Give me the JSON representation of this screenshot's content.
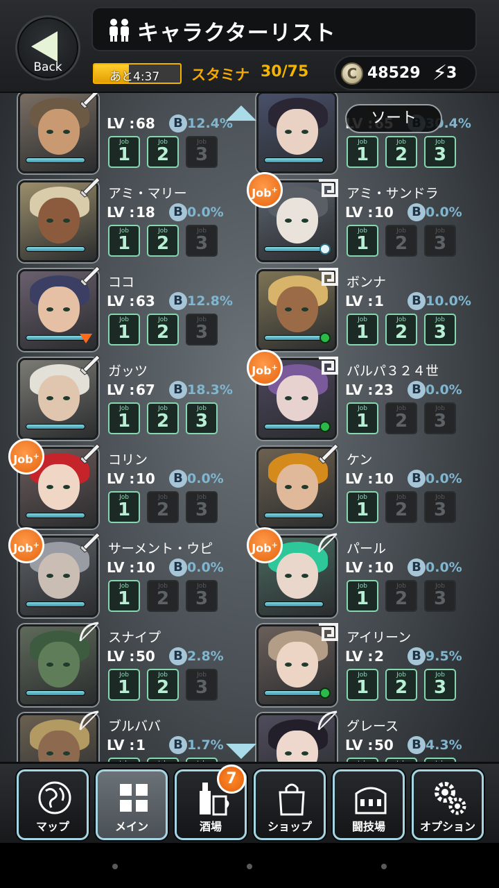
{
  "header": {
    "back_label": "Back",
    "title": "キャラクターリスト",
    "stamina_timer": "あと4:37",
    "stamina_label": "スタミナ",
    "stamina_value": "30/75",
    "stamina_fraction": 0.4,
    "coins": "48529",
    "energy": "3"
  },
  "controls": {
    "sort_label": "ソート"
  },
  "characters": [
    {
      "name": "",
      "lv": "68",
      "b": "12.4%",
      "jobs": [
        1,
        1,
        0
      ],
      "job_badge": false,
      "class": "sword",
      "end": "none"
    },
    {
      "name": "",
      "lv": "65",
      "b": "30.4%",
      "jobs": [
        1,
        1,
        1
      ],
      "job_badge": false,
      "class": "none",
      "end": "none"
    },
    {
      "name": "アミ・マリー",
      "lv": "18",
      "b": "0.0%",
      "jobs": [
        1,
        1,
        0
      ],
      "job_badge": false,
      "class": "sword",
      "end": "none"
    },
    {
      "name": "アミ・サンドラ",
      "lv": "10",
      "b": "0.0%",
      "jobs": [
        1,
        0,
        0
      ],
      "job_badge": true,
      "class": "spiral",
      "end": "white"
    },
    {
      "name": "ココ",
      "lv": "63",
      "b": "12.8%",
      "jobs": [
        1,
        1,
        0
      ],
      "job_badge": false,
      "class": "sword",
      "end": "tri"
    },
    {
      "name": "ボンナ",
      "lv": "1",
      "b": "10.0%",
      "jobs": [
        1,
        1,
        1
      ],
      "job_badge": false,
      "class": "spiral",
      "end": "green"
    },
    {
      "name": "ガッツ",
      "lv": "67",
      "b": "18.3%",
      "jobs": [
        1,
        1,
        1
      ],
      "job_badge": false,
      "class": "sword",
      "end": "none"
    },
    {
      "name": "パルパ３２４世",
      "lv": "23",
      "b": "0.0%",
      "jobs": [
        1,
        0,
        0
      ],
      "job_badge": true,
      "class": "spiral",
      "end": "green"
    },
    {
      "name": "コリン",
      "lv": "10",
      "b": "0.0%",
      "jobs": [
        1,
        0,
        0
      ],
      "job_badge": true,
      "class": "sword",
      "end": "none"
    },
    {
      "name": "ケン",
      "lv": "10",
      "b": "0.0%",
      "jobs": [
        1,
        0,
        0
      ],
      "job_badge": false,
      "class": "sword",
      "end": "none"
    },
    {
      "name": "サーメント・ウピ",
      "lv": "10",
      "b": "0.0%",
      "jobs": [
        1,
        0,
        0
      ],
      "job_badge": true,
      "class": "sword",
      "end": "none"
    },
    {
      "name": "パール",
      "lv": "10",
      "b": "0.0%",
      "jobs": [
        1,
        0,
        0
      ],
      "job_badge": true,
      "class": "bow",
      "end": "none"
    },
    {
      "name": "スナイプ",
      "lv": "50",
      "b": "2.8%",
      "jobs": [
        1,
        1,
        0
      ],
      "job_badge": false,
      "class": "bow",
      "end": "none"
    },
    {
      "name": "アイリーン",
      "lv": "2",
      "b": "9.5%",
      "jobs": [
        1,
        1,
        1
      ],
      "job_badge": false,
      "class": "spiral",
      "end": "green"
    },
    {
      "name": "ブルババ",
      "lv": "1",
      "b": "1.7%",
      "jobs": [
        1,
        1,
        1
      ],
      "job_badge": false,
      "class": "bow",
      "end": "none"
    },
    {
      "name": "グレース",
      "lv": "50",
      "b": "4.3%",
      "jobs": [
        1,
        1,
        1
      ],
      "job_badge": false,
      "class": "bow",
      "end": "none"
    }
  ],
  "labels": {
    "lv": "LV :",
    "b": "B",
    "job": "Job",
    "job_badge": "Job"
  },
  "nav": [
    {
      "label": "マップ",
      "icon": "map-globe-icon"
    },
    {
      "label": "メイン",
      "icon": "grid-icon"
    },
    {
      "label": "酒場",
      "icon": "tavern-bottle-icon",
      "badge": "7"
    },
    {
      "label": "ショップ",
      "icon": "shopping-bag-icon"
    },
    {
      "label": "闘技場",
      "icon": "colosseum-icon"
    },
    {
      "label": "オプション",
      "icon": "gears-icon"
    }
  ],
  "colors": {
    "accent_teal": "#87d8b2",
    "stamina_orange": "#f5a800",
    "job_badge_orange": "#e5640e",
    "b_value_blue": "#7fb6d0"
  }
}
